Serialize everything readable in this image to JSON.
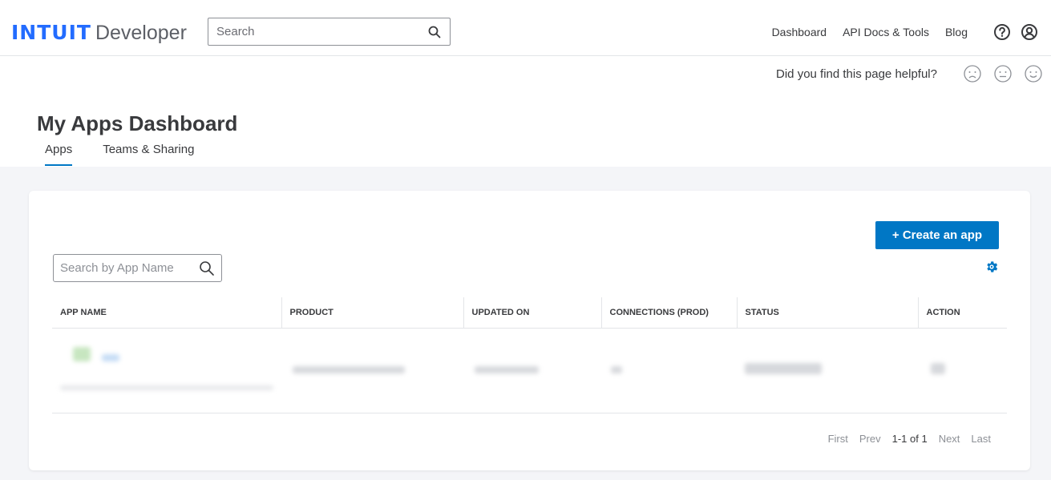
{
  "header": {
    "logo_mark": "INTUIT",
    "logo_text": "Developer",
    "search_placeholder": "Search",
    "nav": [
      "Dashboard",
      "API Docs & Tools",
      "Blog"
    ]
  },
  "feedback": {
    "question": "Did you find this page helpful?"
  },
  "page": {
    "title": "My Apps Dashboard",
    "tabs": [
      "Apps",
      "Teams & Sharing"
    ]
  },
  "apps": {
    "create_label": "+ Create an app",
    "search_placeholder": "Search by App Name",
    "columns": [
      "APP NAME",
      "PRODUCT",
      "UPDATED ON",
      "CONNECTIONS (PROD)",
      "STATUS",
      "ACTION"
    ]
  },
  "pager": {
    "first": "First",
    "prev": "Prev",
    "range": "1-1 of 1",
    "next": "Next",
    "last": "Last"
  },
  "colors": {
    "accent": "#0077c5",
    "logo": "#236cff"
  }
}
